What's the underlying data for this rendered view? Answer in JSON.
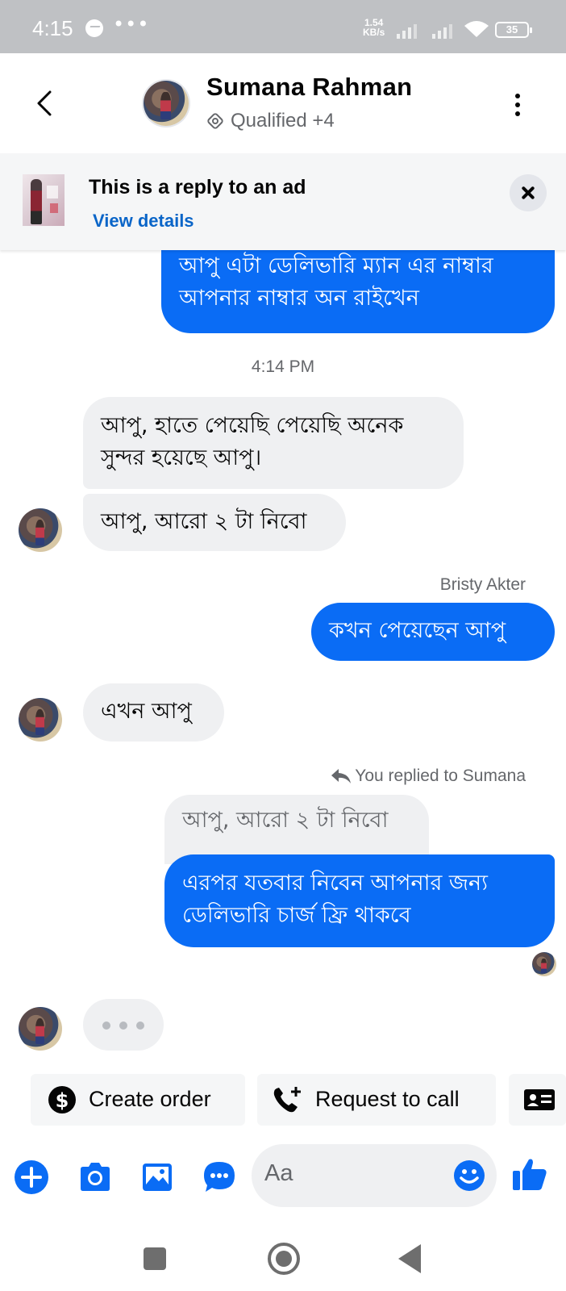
{
  "status_bar": {
    "time": "4:15",
    "more": "•••",
    "speed_value": "1.54",
    "speed_unit": "KB/s",
    "battery": "35"
  },
  "header": {
    "contact_name": "Sumana Rahman",
    "label": "Qualified +4"
  },
  "ad_banner": {
    "title": "This is a reply to an ad",
    "link": "View details"
  },
  "messages": {
    "m1": "আপু এটা ডেলিভারি ম্যান এর নাম্বার\nআপনার নাম্বার অন রাইখেন",
    "timestamp": "4:14 PM",
    "m2": "আপু, হাতে পেয়েছি পেয়েছি অনেক\nসুন্দর হয়েছে আপু।",
    "m3": "আপু, আরো ২ টা নিবো",
    "sender": "Bristy Akter",
    "m4": "কখন পেয়েছেন আপু",
    "m5": "এখন আপু",
    "reply_label": "You replied to Sumana",
    "quoted": "আপু, আরো ২ টা নিবো",
    "m6": "এরপর যতবার নিবেন আপনার জন্য\nডেলিভারি চার্জ ফ্রি থাকবে"
  },
  "quick_actions": {
    "create_order": "Create order",
    "request_call": "Request to call"
  },
  "composer": {
    "placeholder": "Aa"
  },
  "colors": {
    "accent": "#0a6cf5",
    "incoming_bubble": "#eff0f2",
    "status_bar": "#bfc1c4"
  },
  "icons": [
    "messenger-icon",
    "signal-icon",
    "wifi-icon",
    "battery-icon",
    "back-chevron-icon",
    "more-vertical-icon",
    "tag-icon",
    "close-icon",
    "reply-arrow-icon",
    "dollar-icon",
    "phone-plus-icon",
    "contact-card-icon",
    "plus-icon",
    "camera-icon",
    "gallery-icon",
    "chat-bubble-icon",
    "emoji-icon",
    "like-icon"
  ]
}
